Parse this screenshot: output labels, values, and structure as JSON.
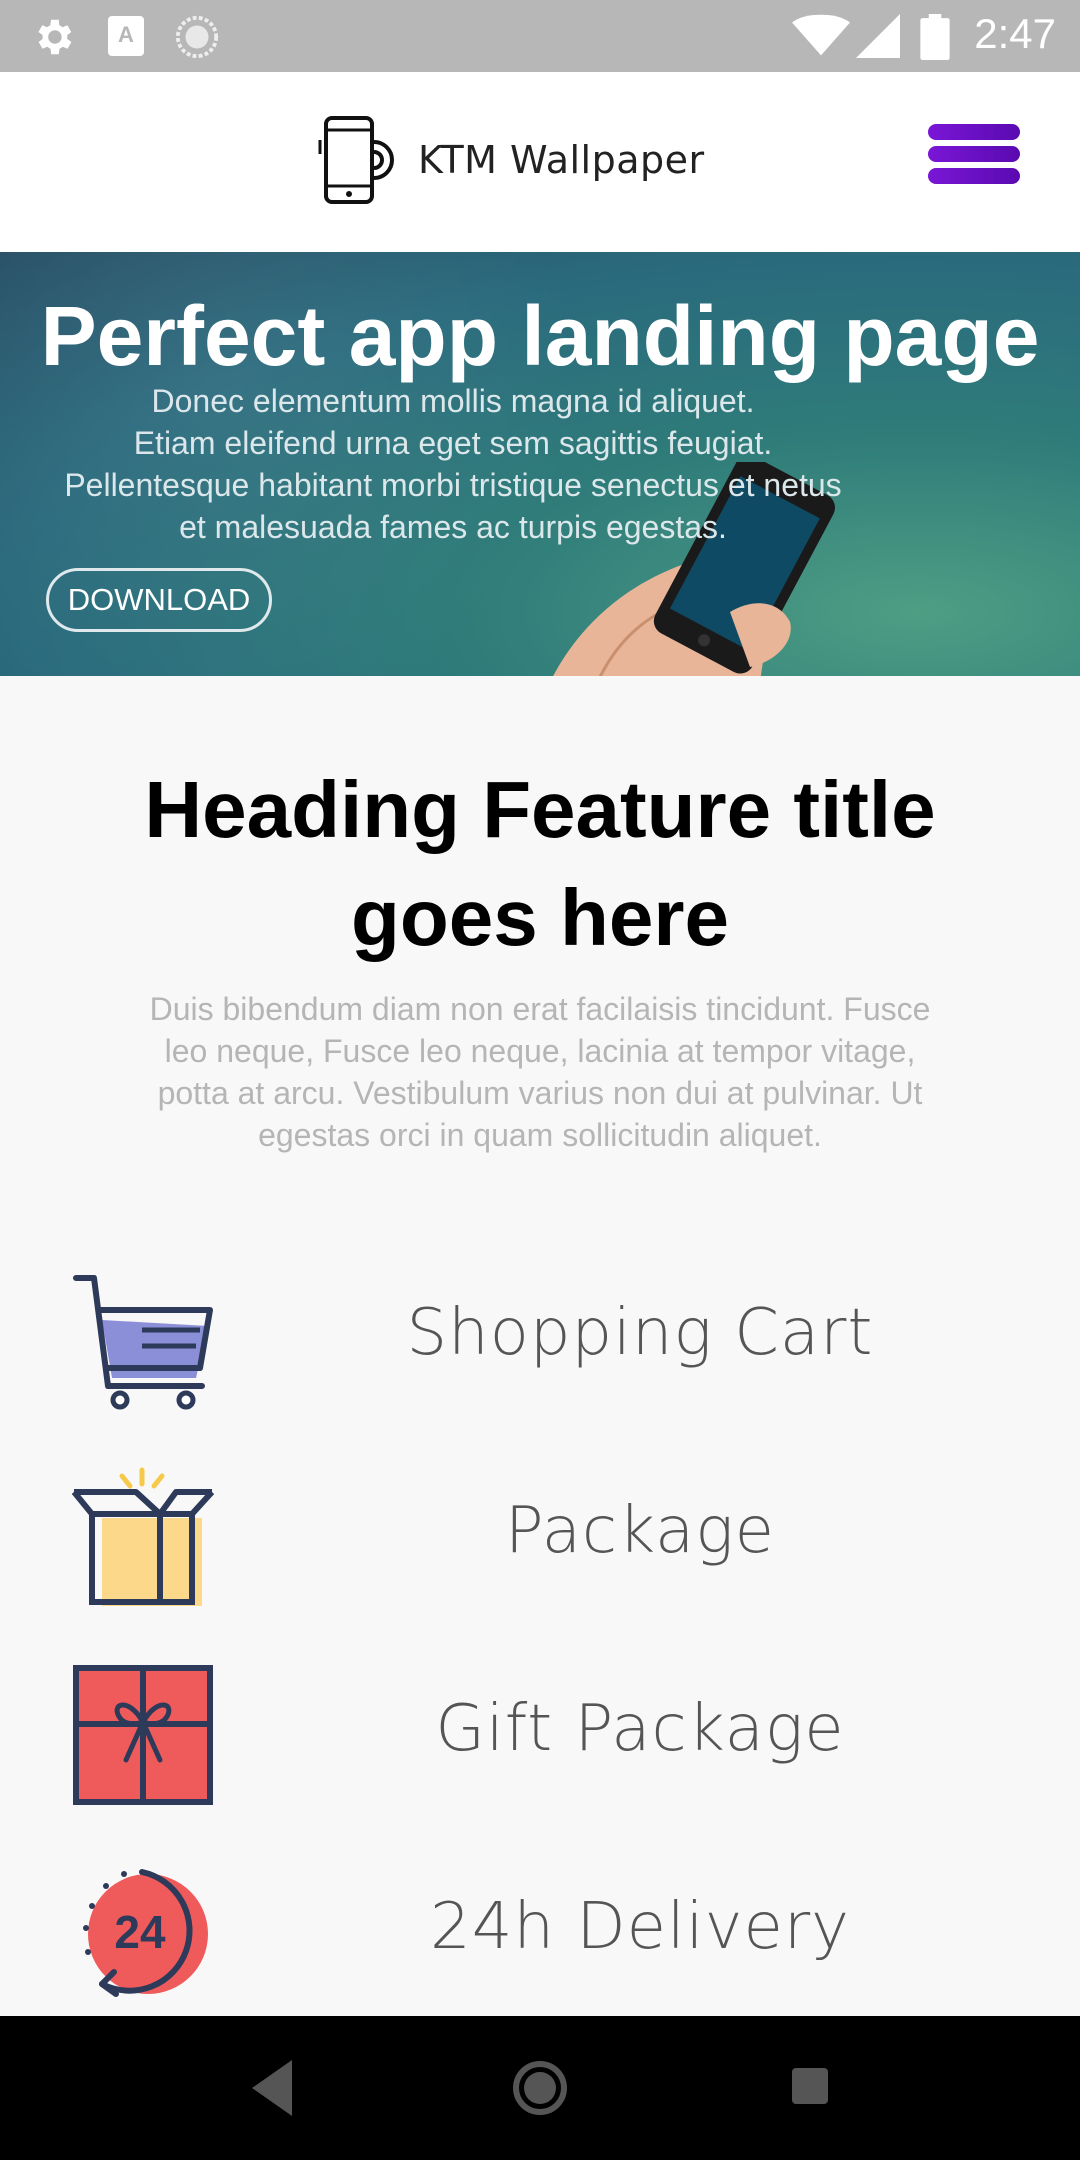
{
  "status_bar": {
    "time": "2:47",
    "left_icons": [
      "gear-icon",
      "font-a-icon",
      "circle-loader-icon"
    ],
    "right_icons": [
      "wifi-icon",
      "signal-icon",
      "battery-icon"
    ]
  },
  "header": {
    "app_name": "KTM Wallpaper",
    "menu_color": "#6a10c4"
  },
  "hero": {
    "title": "Perfect app landing page",
    "subtitle_lines": [
      "Donec elementum mollis magna id aliquet.",
      "Etiam eleifend urna eget sem sagittis feugiat.",
      "Pellentesque habitant morbi tristique senectus et netus",
      "et malesuada fames ac turpis egestas."
    ],
    "download_label": "DOWNLOAD"
  },
  "features": {
    "title_line1": "Heading Feature title",
    "title_line2": "goes here",
    "description_lines": [
      "Duis bibendum diam non erat facilaisis tincidunt. Fusce",
      "leo neque, Fusce leo neque, lacinia at tempor vitage,",
      "potta at arcu. Vestibulum varius non dui at pulvinar. Ut",
      "egestas orci in quam sollicitudin aliquet."
    ],
    "items": [
      {
        "label": "Shopping Cart",
        "icon": "shopping-cart-icon"
      },
      {
        "label": "Package",
        "icon": "package-box-icon"
      },
      {
        "label": "Gift Package",
        "icon": "gift-icon"
      },
      {
        "label": "24h Delivery",
        "icon": "delivery-24h-icon"
      }
    ]
  },
  "nav_bar": {
    "buttons": [
      "back-icon",
      "home-icon",
      "recents-icon"
    ]
  }
}
